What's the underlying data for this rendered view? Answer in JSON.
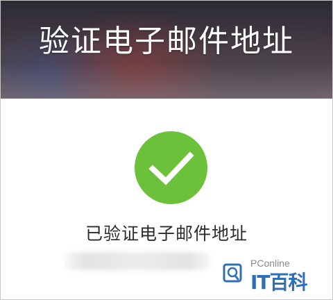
{
  "header": {
    "title": "验证电子邮件地址"
  },
  "main": {
    "status_icon": "check-circle-icon",
    "status_text": "已验证电子邮件地址",
    "email_value": "",
    "accent_color": "#6cc13a"
  },
  "watermark": {
    "brand": "PConline",
    "name": "IT百科",
    "icon": "magnifier-logo-icon"
  }
}
